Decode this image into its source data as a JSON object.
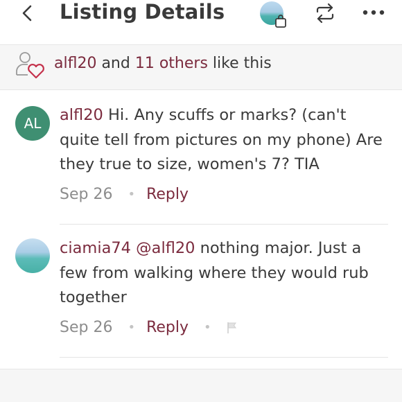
{
  "header": {
    "title": "Listing Details",
    "icons": {
      "back": "chevron-left-icon",
      "cart": "shopping-bag-icon",
      "repost": "repost-icon",
      "more": "more-horizontal-icon"
    }
  },
  "likes": {
    "user": "alfl20",
    "and_text": "and",
    "others": "11 others",
    "suffix": "like this"
  },
  "comments": [
    {
      "avatar_initials": "AL",
      "username": "alfl20",
      "text": "Hi. Any scuffs or marks? (can't quite tell from pictures on my phone) Are they true to size, women's 7?  TIA",
      "date": "Sep 26",
      "reply_label": "Reply"
    },
    {
      "username": "ciamia74",
      "mention": "@alfl20",
      "text": "nothing major. Just a few from walking where they would rub together",
      "date": "Sep 26",
      "reply_label": "Reply"
    }
  ],
  "colors": {
    "accent": "#7b2b3e",
    "avatar_green": "#3f8f72",
    "muted": "#8c8c8c"
  }
}
